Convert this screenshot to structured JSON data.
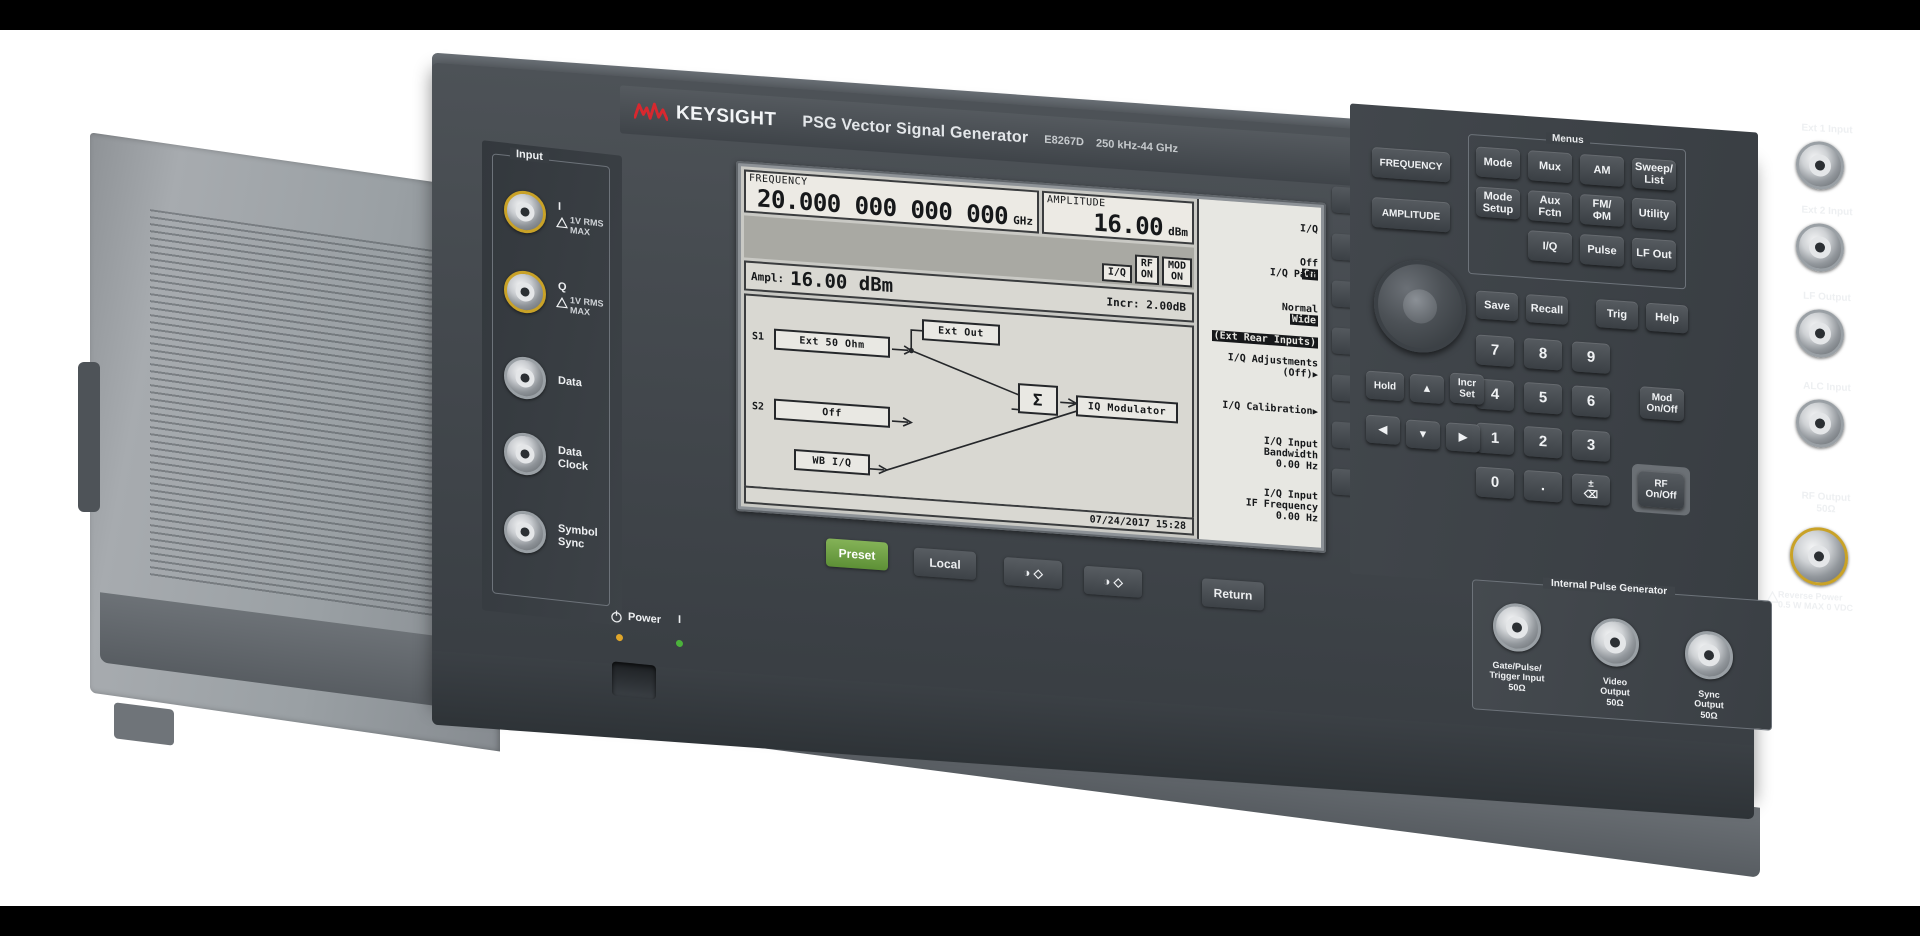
{
  "brand": {
    "name": "KEYSIGHT",
    "product": "PSG Vector Signal Generator",
    "model": "E8267D",
    "freq_range": "250 kHz-44 GHz",
    "family": "PSG",
    "logo_icon": "keysight-wave-logo",
    "accent_red": "#d7282f"
  },
  "display": {
    "frequency": {
      "caption": "FREQUENCY",
      "value": "20.000 000 000 000",
      "unit": "GHz"
    },
    "amplitude": {
      "caption": "AMPLITUDE",
      "value": "16.00",
      "unit": "dBm"
    },
    "status_indicators": [
      {
        "name": "iq-indicator",
        "label": "I/Q"
      },
      {
        "name": "rf-on-indicator",
        "line1": "RF",
        "line2": "ON"
      },
      {
        "name": "mod-on-indicator",
        "line1": "MOD",
        "line2": "ON"
      }
    ],
    "ampl_readout": {
      "key": "Ampl:",
      "value": "16.00 dBm",
      "incr": "Incr: 2.00dB"
    },
    "diagram": {
      "s1_tag": "S1",
      "s1_box": "Ext 50 Ohm",
      "s2_tag": "S2",
      "s2_box": "Off",
      "ext_out_box": "Ext Out",
      "sum_box": "Σ",
      "wb_iq_box": "WB I/Q",
      "iq_mod_box": "IQ Modulator"
    },
    "datetime": "07/24/2017 15:28",
    "softkeys": [
      {
        "name": "softkey-iq-onoff",
        "line1": "I/Q",
        "off": "Off",
        "on": "On",
        "highlight": "on"
      },
      {
        "name": "softkey-iq-path",
        "line1": "I/Q Path",
        "normal": "Normal",
        "wide": "Wide",
        "line3": "(Ext Rear Inputs)",
        "highlight": "wide-and-line3"
      },
      {
        "name": "softkey-blank-3",
        "text": ""
      },
      {
        "name": "softkey-iq-adjustments",
        "text": "I/Q Adjustments\n(Off)",
        "arrow": "▶"
      },
      {
        "name": "softkey-iq-calibration",
        "text": "I/Q Calibration",
        "arrow": "▶"
      },
      {
        "name": "softkey-iq-input-bandwidth",
        "text": "I/Q Input\nBandwidth\n0.00 Hz"
      },
      {
        "name": "softkey-iq-input-if-frequency",
        "text": "I/Q Input\nIF Frequency\n0.00 Hz"
      }
    ]
  },
  "left_inputs": {
    "group_title": "Input",
    "connectors": [
      {
        "name": "connector-i",
        "label": "I",
        "sub": "1V RMS\nMAX",
        "warn": true,
        "gold": true
      },
      {
        "name": "connector-q",
        "label": "Q",
        "sub": "1V RMS\nMAX",
        "warn": true,
        "gold": true
      },
      {
        "name": "connector-data",
        "label": "Data",
        "sub": "",
        "warn": false,
        "gold": false
      },
      {
        "name": "connector-data-clock",
        "label": "Data\nClock",
        "sub": "",
        "warn": false,
        "gold": false
      },
      {
        "name": "connector-symbol-sync",
        "label": "Symbol\nSync",
        "sub": "",
        "warn": false,
        "gold": false
      }
    ]
  },
  "bottom_buttons": [
    {
      "name": "preset-button",
      "label": "Preset",
      "style": "green"
    },
    {
      "name": "local-button",
      "label": "Local",
      "style": "dark"
    },
    {
      "name": "contrast-decrease-button",
      "label": "◑ ◇",
      "style": "dark"
    },
    {
      "name": "contrast-increase-button",
      "label": "◑ ◇",
      "style": "dark"
    },
    {
      "name": "return-button",
      "label": "Return",
      "style": "dark"
    }
  ],
  "keypad": {
    "frequency_key": "FREQUENCY",
    "amplitude_key": "AMPLITUDE",
    "menus_title": "Menus",
    "menus_keys": [
      "Mode",
      "Mux",
      "AM",
      "Sweep/\nList",
      "Mode\nSetup",
      "Aux\nFctn",
      "FM/\nΦM",
      "Utility",
      "",
      "I/Q",
      "Pulse",
      "LF Out"
    ],
    "util_keys": [
      "Save",
      "Recall",
      "Trig",
      "Help"
    ],
    "numeric_keys": [
      "7",
      "8",
      "9",
      "4",
      "5",
      "6",
      "1",
      "2",
      "3",
      "0",
      ".",
      "±\n⌫"
    ],
    "nav_keys": [
      "Hold",
      "▲",
      "Incr\nSet",
      "◀",
      "▼",
      "▶"
    ],
    "mod_onoff": "Mod\nOn/Off",
    "rf_onoff": "RF\nOn/Off"
  },
  "right_connectors": [
    {
      "name": "ext-1-input-connector",
      "label": "Ext 1 Input"
    },
    {
      "name": "ext-2-input-connector",
      "label": "Ext 2 Input"
    },
    {
      "name": "lf-output-connector",
      "label": "LF Output"
    },
    {
      "name": "alc-input-connector",
      "label": "ALC Input"
    }
  ],
  "rf_output": {
    "label": "RF Output\n50Ω",
    "warning": "Reverse Power\n0.5 W MAX 0 VDC",
    "warn_icon": "warning-triangle-icon"
  },
  "pulse_generator": {
    "title": "Internal Pulse Generator",
    "connectors": [
      {
        "name": "gate-pulse-trigger-input-connector",
        "label": "Gate/Pulse/\nTrigger Input\n50Ω"
      },
      {
        "name": "video-output-connector",
        "label": "Video\nOutput\n50Ω"
      },
      {
        "name": "sync-output-connector",
        "label": "Sync\nOutput\n50Ω"
      }
    ]
  },
  "power": {
    "label": "Power",
    "symbol": "I",
    "power_icon": "power-symbol-icon",
    "standby_led_color": "#e0a62a",
    "on_led_color": "#4bb23b"
  }
}
